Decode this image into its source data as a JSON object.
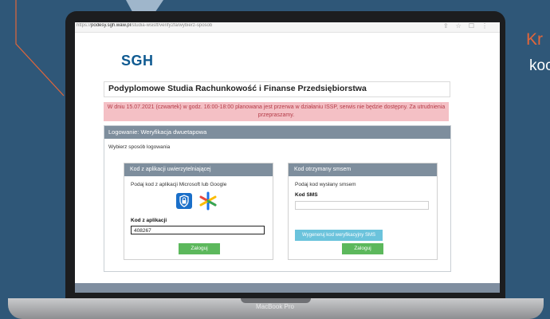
{
  "promo": {
    "line1": "Kr",
    "line2": "koc"
  },
  "laptop": {
    "brand_label": "MacBook Pro"
  },
  "browser": {
    "url_prefix": "https://",
    "url_domain": "podesy.sgh.waw.pl",
    "url_path": "/studia-wsisff/verify2fa/wybierz-sposob"
  },
  "page": {
    "logo": "SGH",
    "program_title": "Podyplomowe Studia Rachunkowość i Finanse Przedsiębiorstwa",
    "alert_text": "W dniu 15.07.2021 (czwartek) w godz. 16:00-18:00 planowana jest przerwa w działaniu ISSP, serwis nie będzie dostępny. Za utrudnienia przepraszamy.",
    "panel_title": "Logowanie: Weryfikacja dwuetapowa",
    "choose_label": "Wybierz sposób logowania"
  },
  "app_card": {
    "title": "Kod z aplikacji uwierzytelniającej",
    "hint": "Podaj kod z aplikacji Microsoft lub Google",
    "field_label": "Kod z aplikacji",
    "field_value": "408267",
    "submit_label": "Zaloguj",
    "icons": [
      "microsoft-authenticator-icon",
      "google-authenticator-icon"
    ]
  },
  "sms_card": {
    "title": "Kod otrzymany smsem",
    "hint": "Podaj kod wysłany smsem",
    "field_label": "Kod SMS",
    "field_value": "",
    "generate_label": "Wygeneruj kod weryfikacyjny SMS",
    "submit_label": "Zaloguj"
  },
  "colors": {
    "background": "#2f5778",
    "accent_orange": "#e2663a",
    "header_gray": "#7e8e9d",
    "alert_bg": "#f4c0c5",
    "alert_text": "#b43a47",
    "logo_blue": "#0f5a91",
    "button_green": "#5cb85c",
    "button_blue": "#6bc3dc"
  }
}
